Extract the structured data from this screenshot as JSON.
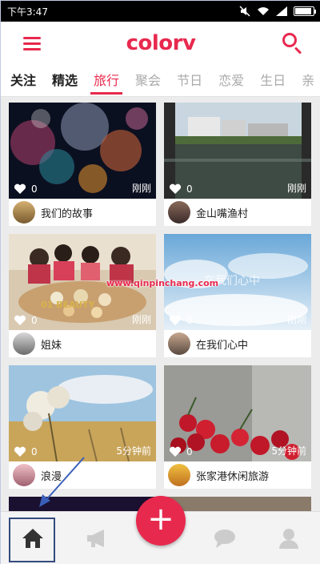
{
  "status": {
    "time": "下午3:47"
  },
  "header": {
    "logo": "colorv"
  },
  "tabs": [
    {
      "label": "关注"
    },
    {
      "label": "精选"
    },
    {
      "label": "旅行"
    },
    {
      "label": "聚会"
    },
    {
      "label": "节日"
    },
    {
      "label": "恋爱"
    },
    {
      "label": "生日"
    },
    {
      "label": "亲"
    }
  ],
  "cards": [
    {
      "title": "我们的故事",
      "likes": "0",
      "time": "刚刚"
    },
    {
      "title": "金山嘴渔村",
      "likes": "0",
      "time": "刚刚"
    },
    {
      "title": "姐妹",
      "likes": "0",
      "time": "刚刚",
      "overlay": "01 BEAUTY"
    },
    {
      "title": "在我们心中",
      "likes": "0",
      "time": "刚刚",
      "overlay": "在我们心中"
    },
    {
      "title": "浪漫",
      "likes": "0",
      "time": "5分钟前"
    },
    {
      "title": "张家港休闲旅游",
      "likes": "0",
      "time": "5分钟前"
    }
  ],
  "watermark": "www.qinpinchang.com",
  "fab": {
    "label": "+"
  },
  "colors": {
    "accent": "#e8294e",
    "highlight_box": "#344a7d"
  },
  "icons": [
    "home-icon",
    "megaphone-icon",
    "plus-icon",
    "chat-icon",
    "profile-icon",
    "menu-icon",
    "search-icon",
    "heart-icon"
  ]
}
